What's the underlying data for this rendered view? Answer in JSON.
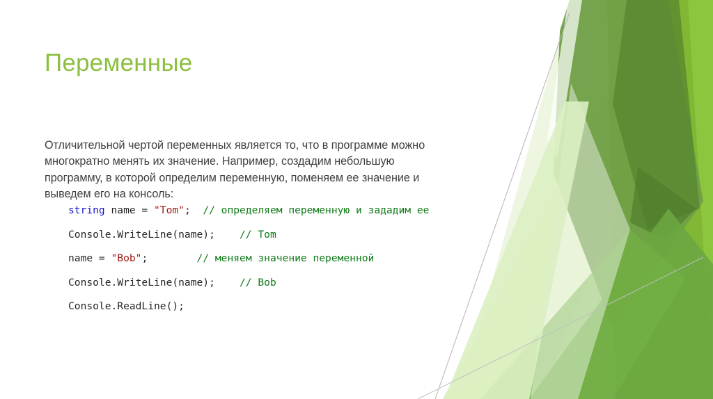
{
  "slide": {
    "title": "Переменные",
    "body_paragraph": "Отличительной чертой переменных является то, что в программе можно многократно менять их значение. Например, создадим небольшую программу, в которой определим переменную, поменяем ее значение и выведем его на консоль:",
    "background_theme": "facet-green-polygons"
  },
  "code": {
    "language": "csharp",
    "lines": [
      {
        "id": "line-1",
        "tokens": [
          {
            "kind": "keyword",
            "text": "string"
          },
          {
            "kind": "plain",
            "text": " name = "
          },
          {
            "kind": "string",
            "text": "\"Tom\""
          },
          {
            "kind": "plain",
            "text": ";  "
          },
          {
            "kind": "comment",
            "text": "// определяем переменную и зададим ее"
          }
        ]
      },
      {
        "id": "line-2",
        "tokens": [
          {
            "kind": "plain",
            "text": "Console.WriteLine(name);    "
          },
          {
            "kind": "comment",
            "text": "// Tom"
          }
        ]
      },
      {
        "id": "line-3",
        "tokens": [
          {
            "kind": "plain",
            "text": "name = "
          },
          {
            "kind": "string",
            "text": "\"Bob\""
          },
          {
            "kind": "plain",
            "text": ";        "
          },
          {
            "kind": "comment",
            "text": "// меняем значение переменной"
          }
        ]
      },
      {
        "id": "line-4",
        "tokens": [
          {
            "kind": "plain",
            "text": "Console.WriteLine(name);    "
          },
          {
            "kind": "comment",
            "text": "// Bob"
          }
        ]
      },
      {
        "id": "line-5",
        "tokens": [
          {
            "kind": "plain",
            "text": "Console.ReadLine();"
          }
        ]
      }
    ]
  },
  "colors": {
    "title_green": "#8cbf3f",
    "body_text": "#3f3f3f",
    "code_keyword": "#1414d2",
    "code_string": "#a31515",
    "code_comment": "#0f7b17",
    "code_plain": "#262626",
    "accent_dark_green": "#5c8a3c",
    "accent_mid_green": "#6f9f46",
    "accent_bright_green": "#7fb632",
    "accent_lime": "#8cc63f",
    "accent_pale_green": "#d7e9b6",
    "accent_very_pale": "#eaf4da",
    "hairline_gray": "#b9b9b9",
    "background": "#ffffff"
  }
}
